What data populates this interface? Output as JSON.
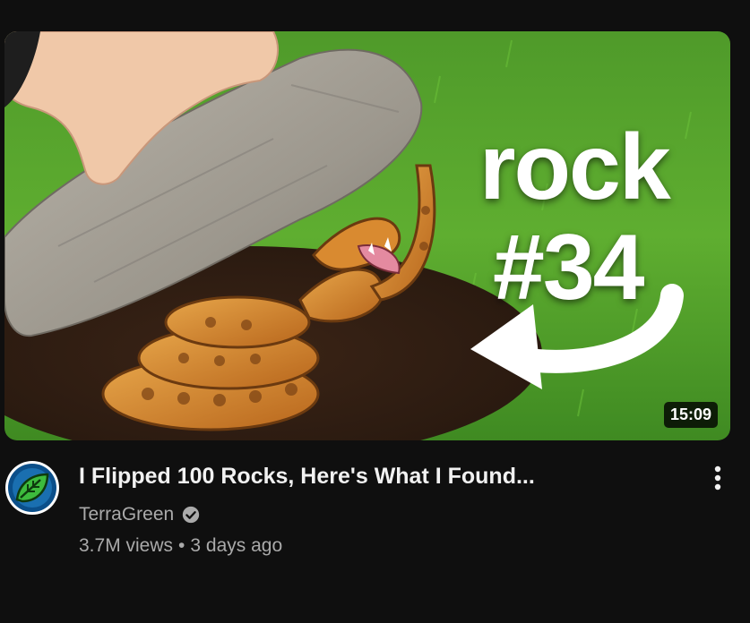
{
  "video": {
    "thumbnail": {
      "overlay_word": "rock",
      "overlay_number": "#34",
      "duration": "15:09"
    },
    "title": "I Flipped 100 Rocks, Here's What I Found...",
    "channel": {
      "name": "TerraGreen",
      "verified": true,
      "avatar_icon": "leaf-avatar-icon"
    },
    "views": "3.7M views",
    "separator": "•",
    "age": "3 days ago",
    "menu_icon": "more-vertical-icon"
  },
  "colors": {
    "background": "#0f0f0f",
    "title_text": "#f1f1f1",
    "secondary_text": "#aaaaaa",
    "avatar_ring": "#0b4f8a",
    "avatar_leaf": "#3dbb3d"
  }
}
